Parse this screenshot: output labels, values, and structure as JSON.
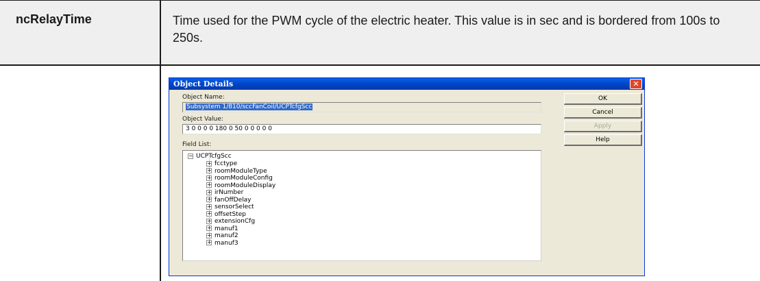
{
  "table": {
    "param_name": "ncRelayTime",
    "description": "Time used for the PWM cycle of the electric heater. This value is in sec and is bordered from 100s to 250s."
  },
  "dialog": {
    "title": "Object Details",
    "object_name_label": "Object Name:",
    "object_name_value": "Subsystem 1/810/sccFanCoil/UCPTcfgScc",
    "object_value_label": "Object Value:",
    "object_value_value": "3 0 0 0 0 180 0 50 0 0 0 0 0",
    "field_list_label": "Field List:",
    "tree_root": "UCPTcfgScc",
    "tree_items": [
      "fcctype",
      "roomModuleType",
      "roomModuleConfig",
      "roomModuleDisplay",
      "irNumber",
      "fanOffDelay",
      "sensorSelect",
      "offsetStep",
      "extensionCfg",
      "manuf1",
      "manuf2",
      "manuf3"
    ],
    "buttons": {
      "ok": "OK",
      "cancel": "Cancel",
      "apply": "Apply",
      "help": "Help"
    }
  },
  "colors": {
    "titlebar": "#0046c8",
    "selection": "#3169c6",
    "dialog_bg": "#ece9d8",
    "close_button": "#e0462c"
  }
}
